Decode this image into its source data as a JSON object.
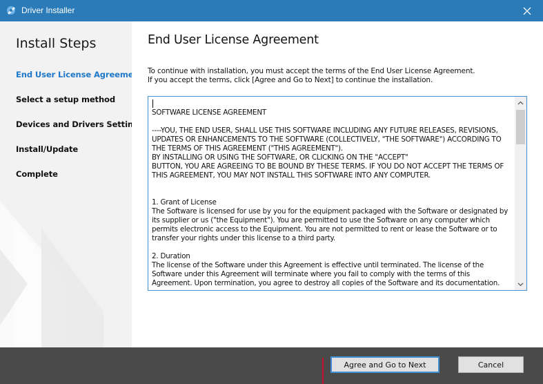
{
  "window": {
    "title": "Driver Installer",
    "accent_color": "#2b7bb9",
    "app_icon": "installer-app-icon",
    "close_icon": "close-icon"
  },
  "sidebar": {
    "title": "Install Steps",
    "active_color": "#1e78c9",
    "steps": [
      {
        "label": "End User License Agreement",
        "active": true
      },
      {
        "label": "Select a setup method",
        "active": false
      },
      {
        "label": "Devices and Drivers Settings",
        "active": false
      },
      {
        "label": "Install/Update",
        "active": false
      },
      {
        "label": "Complete",
        "active": false
      }
    ]
  },
  "main": {
    "title": "End User License Agreement",
    "instructions": [
      "To continue with installation, you must accept the terms of the End User License Agreement.",
      "If you accept the terms, click [Agree and Go to Next] to continue the installation."
    ],
    "eula_text": "SOFTWARE LICENSE AGREEMENT\n\n----YOU, THE END USER, SHALL USE THIS SOFTWARE INCLUDING ANY FUTURE RELEASES, REVISIONS, UPDATES OR ENHANCEMENTS TO THE SOFTWARE (COLLECTIVELY, \"THE SOFTWARE\") ACCORDING TO THE TERMS OF THIS AGREEMENT (\"THIS AGREEMENT\").\nBY INSTALLING OR USING THE SOFTWARE, OR CLICKING ON THE \"ACCEPT\"\nBUTTON, YOU ARE AGREEING TO BE BOUND BY THESE TERMS. IF YOU DO NOT ACCEPT THE TERMS OF THIS AGREEMENT, YOU MAY NOT INSTALL THIS SOFTWARE INTO ANY COMPUTER.\n\n\n1. Grant of License\nThe Software is licensed for use by you for the equipment packaged with the Software or designated by its supplier or us (\"the Equipment\"). You are permitted to use the Software on any computer which permits electronic access to the Equipment. You are not permitted to rent or lease the Software or to transfer your rights under this license to a third party.\n\n2. Duration\nThe license of the Software under this Agreement is effective until terminated. The license of the Software under this Agreement will terminate where you fail to comply with the terms of this Agreement. Upon termination, you agree to destroy all copies of the Software and its documentation."
  },
  "footer": {
    "agree_label": "Agree and Go to Next",
    "cancel_label": "Cancel"
  }
}
